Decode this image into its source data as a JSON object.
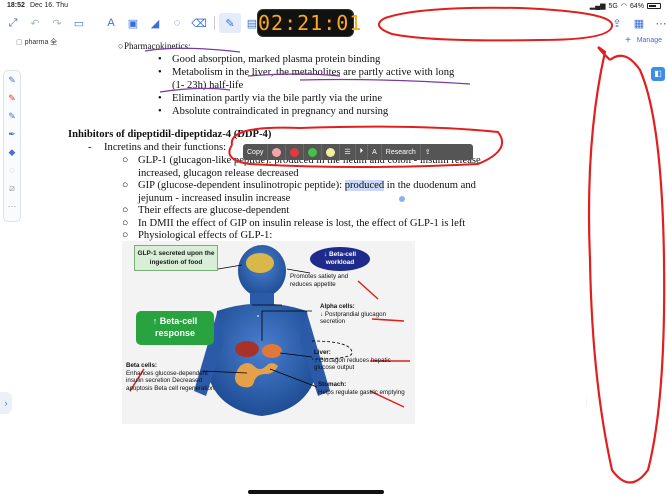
{
  "status": {
    "time": "18:52",
    "date": "Dec 16. Thu",
    "network": "5G",
    "battery": "64%"
  },
  "timer": {
    "display": "02:21:01"
  },
  "tab": {
    "title": "pharma 全",
    "manage_label": "Manage"
  },
  "document": {
    "top_bullets": [
      "Good absorption, marked plasma protein binding",
      "Metabolism in the liver, the metabolites are partly active with long",
      "(1- 23h) half-life",
      "Elimination partly via the bile partly via the urine",
      "Absolute contraindicated in pregnancy and nursing"
    ],
    "heading": "Inhibitors of dipeptidil-dipeptidaz-4 (DDP-4)",
    "dash_item": "Incretins and their functions:",
    "sub_items": {
      "glp1_a": "GLP-1 (glucagon-like peptide): produced in the ileum and colon - insulin release",
      "glp1_b": "increased, glucagon release decreased",
      "gip_a_pre": "GIP (glucose-dependent insulinotropic peptide): ",
      "gip_a_sel": "produced",
      "gip_a_post": " in the duodenum and",
      "gip_b": "jejunum - increased insulin increase",
      "effects": "Their effects are glucose-dependent",
      "dmii": "In DMII the effect of GIP on insulin release is lost, the effect of GLP-1 is left",
      "physio": "Physiological effects of GLP-1:"
    }
  },
  "popup": {
    "copy": "Copy",
    "research": "Research",
    "colors": [
      "#f2a6a6",
      "#e23b3b",
      "#43c24a",
      "#f2efa0"
    ]
  },
  "diagram": {
    "glp_box": "GLP-1 secreted upon the ingestion of food",
    "beta_response": "↑ Beta-cell response",
    "beta_workload": "↓ Beta-cell workload",
    "satiety": "Promotes satiety and reduces appetite",
    "alpha_title": "Alpha cells:",
    "alpha_body": "↓ Postprandial glucagon secretion",
    "liver_title": "Liver:",
    "liver_body": "↓ Glucagon reduces hepatic glucose output",
    "stomach_title": "Stomach:",
    "stomach_body": "Helps regulate gastric emptying",
    "beta_cells_title": "Beta cells:",
    "beta_cells_body": "Enhances glucose-dependent insulin secretion Decreased apoptosis Beta cell regeneration"
  },
  "colors": {
    "accent": "#3a6fd8",
    "annotation_red": "#e21f1f",
    "annotation_purple": "#7a3ba0"
  }
}
